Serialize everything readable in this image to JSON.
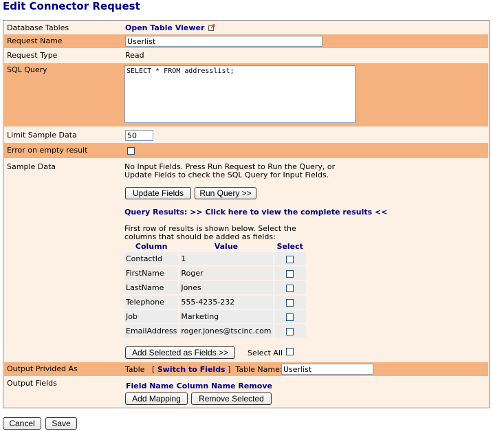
{
  "page_title": "Edit Connector Request",
  "rows": {
    "database_tables": {
      "label": "Database Tables",
      "link": "Open Table Viewer"
    },
    "request_name": {
      "label": "Request Name",
      "value": "Userlist"
    },
    "request_type": {
      "label": "Request Type",
      "value": "Read"
    },
    "sql_query": {
      "label": "SQL Query",
      "value": "SELECT * FROM addresslist;"
    },
    "limit_sample": {
      "label": "Limit Sample Data",
      "value": "50"
    },
    "error_empty": {
      "label": "Error on empty result"
    },
    "sample_data": {
      "label": "Sample Data",
      "info_line1": "No Input Fields. Press Run Request to Run the Query, or",
      "info_line2": "Update Fields to check the SQL Query for Input Fields.",
      "update_fields_button": "Update Fields",
      "run_query_button": "Run Query >>",
      "query_results_label": "Query Results:",
      "query_results_link": ">> Click here to view the complete results <<",
      "first_row_line1": "First row of results is shown below. Select the",
      "first_row_line2": "columns that should be added as fields:",
      "table_headers": {
        "column": "Column",
        "value": "Value",
        "select": "Select"
      },
      "table_rows": [
        {
          "column": "ContactId",
          "value": "1"
        },
        {
          "column": "FirstName",
          "value": "Roger"
        },
        {
          "column": "LastName",
          "value": "Jones"
        },
        {
          "column": "Telephone",
          "value": "555-4235-232"
        },
        {
          "column": "Job",
          "value": "Marketing"
        },
        {
          "column": "EmailAddress",
          "value": "roger.jones@tscinc.com"
        }
      ],
      "add_selected_button": "Add Selected as Fields >>",
      "select_all_label": "Select All"
    },
    "output_provided": {
      "label": "Output Privided As",
      "type_text": "Table",
      "switch_open": "[",
      "switch_link": "Switch to Fields",
      "switch_close": "]",
      "table_name_label": "Table Name:",
      "table_name_value": "Userlist"
    },
    "output_fields": {
      "label": "Output Fields",
      "headers": [
        "Field Name",
        "Column Name",
        "Remove"
      ],
      "add_mapping_button": "Add Mapping",
      "remove_selected_button": "Remove Selected"
    }
  },
  "footer": {
    "cancel_button": "Cancel",
    "save_button": "Save"
  },
  "colors": {
    "dark_row": "#f5b27f",
    "light_row": "#fdf1e6",
    "link": "#00007f"
  },
  "icons": {
    "external_link": "external-link-icon"
  }
}
